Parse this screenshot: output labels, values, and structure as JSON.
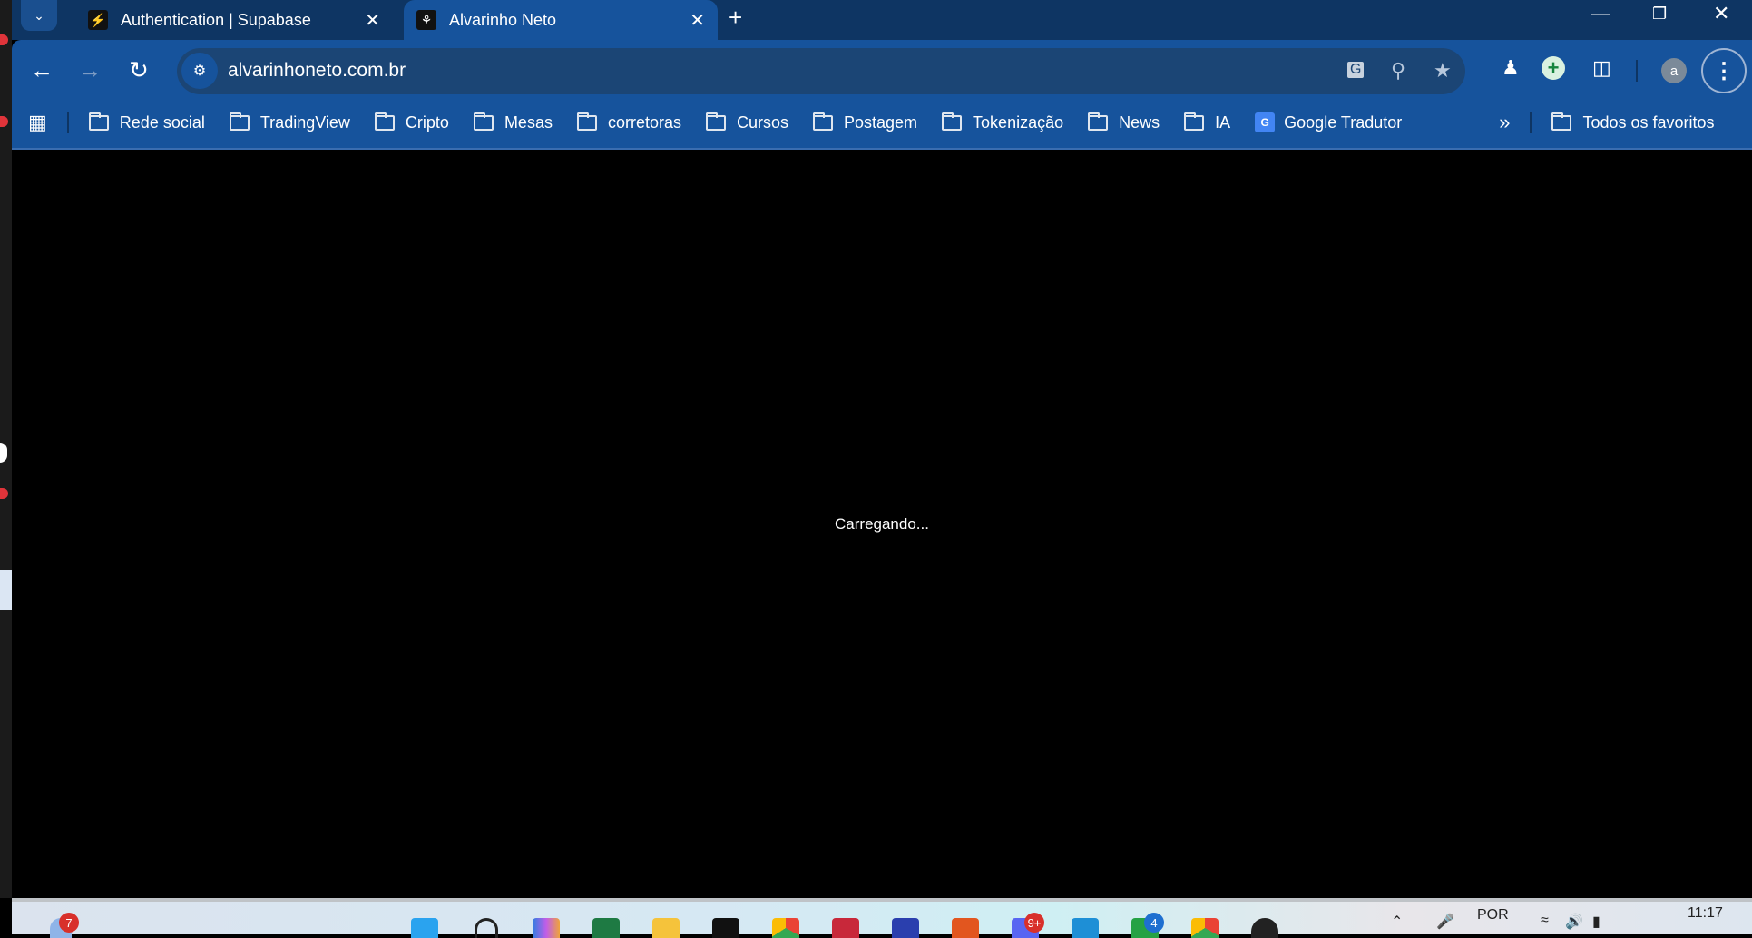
{
  "tabs": [
    {
      "title": "Authentication | Supabase",
      "favicon": "supabase-bolt-icon",
      "active": false
    },
    {
      "title": "Alvarinho Neto",
      "favicon": "octopus-icon",
      "active": true
    }
  ],
  "address_bar": {
    "url": "alvarinhoneto.com.br"
  },
  "bookmarks": [
    {
      "label": "Rede social",
      "icon": "folder-icon"
    },
    {
      "label": "TradingView",
      "icon": "folder-icon"
    },
    {
      "label": "Cripto",
      "icon": "folder-icon"
    },
    {
      "label": "Mesas",
      "icon": "folder-icon"
    },
    {
      "label": "corretoras",
      "icon": "folder-icon"
    },
    {
      "label": "Cursos",
      "icon": "folder-icon"
    },
    {
      "label": "Postagem",
      "icon": "folder-icon"
    },
    {
      "label": "Tokenização",
      "icon": "folder-icon"
    },
    {
      "label": "News",
      "icon": "folder-icon"
    },
    {
      "label": "IA",
      "icon": "folder-icon"
    },
    {
      "label": "Google Tradutor",
      "icon": "google-translate-icon"
    }
  ],
  "all_bookmarks": "Todos os favoritos",
  "profile_initial": "a",
  "page": {
    "loading_text": "Carregando..."
  },
  "taskbar": {
    "widget_badge": "7",
    "discord_badge": "9+",
    "whatsapp_badge": "4",
    "language": "POR",
    "time": "11:17"
  }
}
